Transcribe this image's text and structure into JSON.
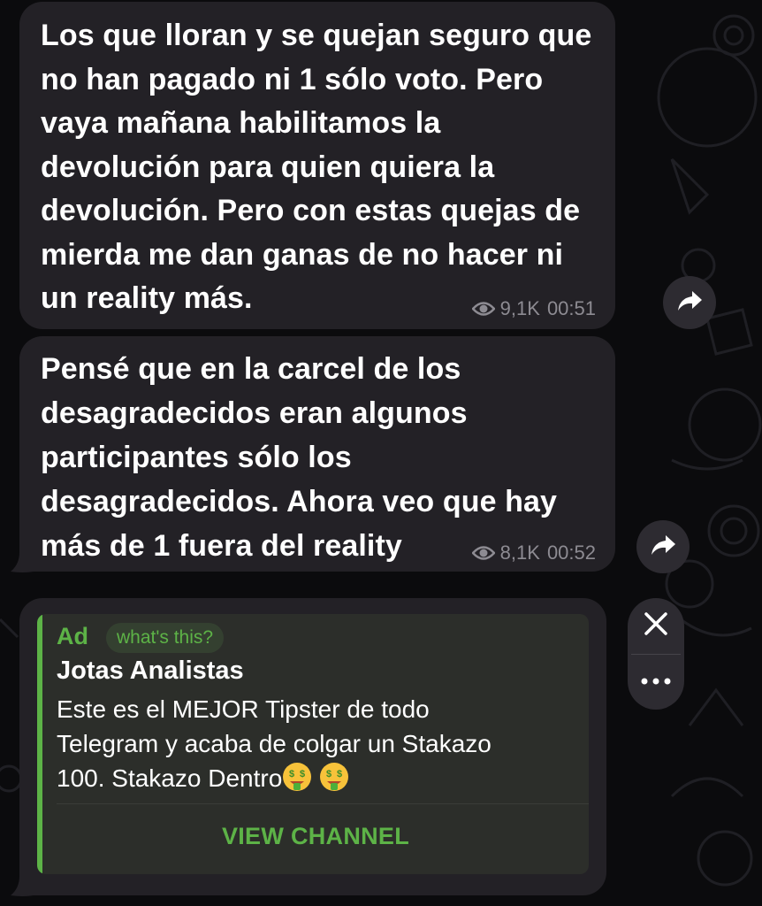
{
  "messages": [
    {
      "text": "Los que lloran y se quejan seguro que\nno han pagado ni 1 sólo voto. Pero\nvaya mañana habilitamos la\ndevolución para quien quiera la\ndevolución. Pero con estas quejas de\nmierda me dan ganas de no hacer ni\nun reality más.",
      "views": "9,1K",
      "time": "00:51"
    },
    {
      "text": "Pensé que en la carcel de los\ndesagradecidos eran algunos\nparticipantes sólo los\ndesagradecidos. Ahora veo que hay\nmás de 1 fuera del reality",
      "views": "8,1K",
      "time": "00:52"
    }
  ],
  "ad": {
    "label": "Ad",
    "whats_this": "what's this?",
    "title": "Jotas Analistas",
    "text": "Este es el MEJOR Tipster de todo\nTelegram y acaba de colgar un Stakazo\n100. Stakazo Dentro",
    "button": "VIEW CHANNEL"
  },
  "icons": {
    "share": "share-arrow-icon",
    "views": "eye-icon",
    "close": "close-icon",
    "more": "more-dots-icon",
    "emoji": "money-mouth-face-emoji"
  },
  "colors": {
    "bubble": "#232126",
    "accent": "#5db347",
    "meta": "#8d8b92"
  }
}
